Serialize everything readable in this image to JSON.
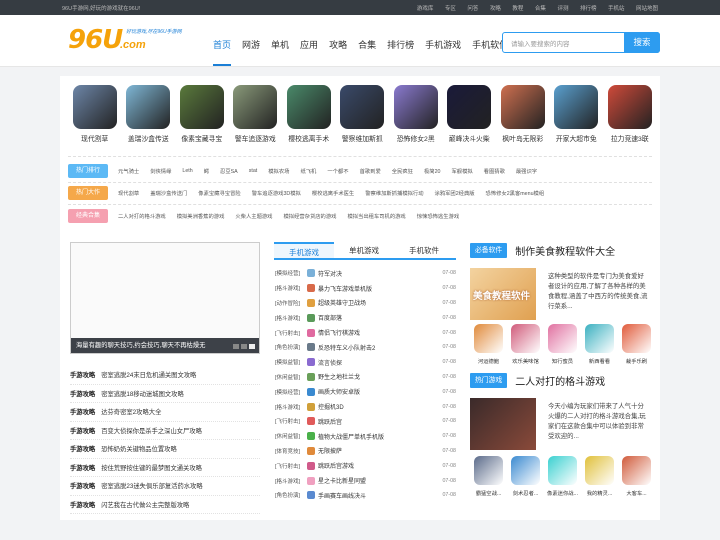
{
  "topbar": {
    "left_text": "96U手游网,好玩的游戏就在96U!",
    "links": [
      "游戏库",
      "专区",
      "问答",
      "攻略",
      "教程",
      "合集",
      "评测",
      "排行榜",
      "手机站",
      "网站地图"
    ]
  },
  "header": {
    "logo_text": "96U",
    "logo_com": ".com",
    "logo_slogan": "好玩游戏,尽在96U手游网"
  },
  "nav": {
    "items": [
      "首页",
      "网游",
      "单机",
      "应用",
      "攻略",
      "合集",
      "排行榜",
      "手机游戏",
      "手机软件"
    ],
    "active": 0
  },
  "search": {
    "placeholder": "请输入要搜索的内容",
    "button": "搜索"
  },
  "apps": [
    {
      "label": "现代割草",
      "color": "#6d86a8"
    },
    {
      "label": "盖瑞沙盒传送",
      "color": "#7fb7d6"
    },
    {
      "label": "像素宝藏寻宝",
      "color": "#5a7a3c"
    },
    {
      "label": "警车追逐游戏",
      "color": "#8a9a7a"
    },
    {
      "label": "樱校逃离手术",
      "color": "#4a8a6a"
    },
    {
      "label": "警察维加斯抓",
      "color": "#3a4a6a"
    },
    {
      "label": "恐怖修女2黑",
      "color": "#8a7ad0"
    },
    {
      "label": "巅峰决斗火柴",
      "color": "#1a1a3a"
    },
    {
      "label": "枫叶岛无限彩",
      "color": "#d07050"
    },
    {
      "label": "开家大超市免",
      "color": "#5aa0d0"
    },
    {
      "label": "拉力竞速3联",
      "color": "#d04a3a"
    }
  ],
  "tag_rows": [
    {
      "tag": "热门排行",
      "color": "#5cb9f5",
      "items": [
        "元气骑士",
        "剑侠情缘",
        "Leth",
        "鳄",
        "忍豆SA",
        "stat",
        "模拟农场",
        "纸飞机",
        "一个都不",
        "首歌到爱",
        "全民疯狂",
        "极简20",
        "军舰模拟",
        "看图猜歌",
        "最强识字"
      ]
    },
    {
      "tag": "热门大作",
      "color": "#f5a84a",
      "items": [
        "现代割草",
        "盖瑞沙盒传送门",
        "像素宝藏寻宝冒险",
        "警车追逐游戏3D模拟",
        "樱校逃离手术医生",
        "警察维加斯抓捕模拟行动",
        "涂鸦军团2经典版",
        "恐怖修女2黑客menu模组"
      ]
    },
    {
      "tag": "经典合集",
      "color": "#f5a0b0",
      "items": [
        "二人对打的格斗游戏",
        "模拟美洲香蕉的游戏",
        "火柴人主题游戏",
        "模拟经营杂货店的游戏",
        "模拟当出租车司机的游戏",
        "惊悚恐怖逃生游戏"
      ]
    }
  ],
  "slider": {
    "caption": "海量有趣的聊天技巧,约会技巧,聊天不再枯燥无",
    "dots": 3
  },
  "guides": [
    {
      "cat": "手游攻略",
      "title": "密室逃脱24末日危机通关图文攻略"
    },
    {
      "cat": "手游攻略",
      "title": "密室逃脱18移动迷城图文攻略"
    },
    {
      "cat": "手游攻略",
      "title": "达芬奇密室2攻略大全"
    },
    {
      "cat": "手游攻略",
      "title": "百变大侦探你是杀手之深山女尸攻略"
    },
    {
      "cat": "手游攻略",
      "title": "恐怖奶奶关键物品位置攻略"
    },
    {
      "cat": "手游攻略",
      "title": "按住荒野按住键的最梦图文通关攻略"
    },
    {
      "cat": "手游攻略",
      "title": "密室逃脱23迷失俱乐部复活药水攻略"
    },
    {
      "cat": "手游攻略",
      "title": "闪艺我在古代做公主完整版攻略"
    }
  ],
  "tabs": [
    "手机游戏",
    "单机游戏",
    "手机软件"
  ],
  "tab_list": [
    {
      "cat": "[模拟经营]",
      "name": "符军对决",
      "date": "07-08",
      "color": "#7ab0d8"
    },
    {
      "cat": "[格斗游戏]",
      "name": "暴力飞车游戏单机版",
      "date": "07-08",
      "color": "#d86a4a"
    },
    {
      "cat": "[动作冒险]",
      "name": "超级英雄守卫战场",
      "date": "07-08",
      "color": "#e0a040"
    },
    {
      "cat": "[格斗游戏]",
      "name": "百度部落",
      "date": "07-08",
      "color": "#5a9a5a"
    },
    {
      "cat": "[飞行射击]",
      "name": "情侣飞行棋游戏",
      "date": "07-08",
      "color": "#e06aa0"
    },
    {
      "cat": "[角色扮演]",
      "name": "反恐特车义小队射击2",
      "date": "07-08",
      "color": "#6a7a8a"
    },
    {
      "cat": "[模拟益智]",
      "name": "流言侦探",
      "date": "07-08",
      "color": "#8a6ad0"
    },
    {
      "cat": "[休闲益智]",
      "name": "野生之地杜兰戈",
      "date": "07-08",
      "color": "#6aa05a"
    },
    {
      "cat": "[模拟经营]",
      "name": "画质大师安卓版",
      "date": "07-08",
      "color": "#3a8ad0"
    },
    {
      "cat": "[格斗游戏]",
      "name": "控掘机3D",
      "date": "07-08",
      "color": "#d0a03a"
    },
    {
      "cat": "[飞行射击]",
      "name": "跳跃后宫",
      "date": "07-08",
      "color": "#e05a5a"
    },
    {
      "cat": "[休闲益智]",
      "name": "植物大战僵尸单机手机版",
      "date": "07-08",
      "color": "#4ab04a"
    },
    {
      "cat": "[体育竞技]",
      "name": "无限披萨",
      "date": "07-08",
      "color": "#e08a3a"
    },
    {
      "cat": "[飞行射击]",
      "name": "跳跃后宫游戏",
      "date": "07-08",
      "color": "#d05a8a"
    },
    {
      "cat": "[格斗游戏]",
      "name": "星之卡比新星同盟",
      "date": "07-08",
      "color": "#f0a0c0"
    },
    {
      "cat": "[角色扮演]",
      "name": "手画赛车画线决斗",
      "date": "07-08",
      "color": "#5a8ad0"
    }
  ],
  "section1": {
    "label": "必备软件",
    "title": "制作美食教程软件大全",
    "banner": "美食教程软件",
    "desc": "这种类型的软件是专门为美食爱好者设计的应用,了解了各种各样的美食教程,涵盖了中西方的传统美食,流行菜系...",
    "apps": [
      {
        "label": "河运德鲍",
        "color": "#e08a3a"
      },
      {
        "label": "欢乐美味馆",
        "color": "#d05a7a"
      },
      {
        "label": "知行蜜员",
        "color": "#e070a0"
      },
      {
        "label": "新西看看",
        "color": "#3ab0c0"
      },
      {
        "label": "裁手乐刷",
        "color": "#e05a3a"
      }
    ]
  },
  "section2": {
    "label": "热门游戏",
    "title": "二人对打的格斗游戏",
    "desc": "今天小编为玩家们带来了人气十分火爆的二人对打的格斗游戏合集,玩家们在这款合集中可以体验到非常受欢迎的...",
    "apps": [
      {
        "label": "霸猛空战...",
        "color": "#5a6a8a"
      },
      {
        "label": "剑术忍者...",
        "color": "#3a8ad0"
      },
      {
        "label": "像素迷你战...",
        "color": "#3ad0d0"
      },
      {
        "label": "我的精灵...",
        "color": "#e0c03a"
      },
      {
        "label": "大客车...",
        "color": "#d05a3a"
      }
    ]
  }
}
